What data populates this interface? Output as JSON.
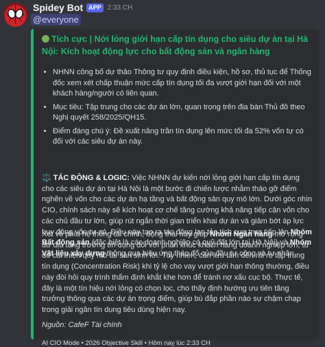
{
  "message": {
    "username": "Spidey Bot",
    "badge": "APP",
    "timestamp": "2:33 CH",
    "mention": "@everyone"
  },
  "embed": {
    "accent_color": "#21b66f",
    "title_icon": "green-circle-icon",
    "title": "Tích cực | Nới lỏng giới hạn cấp tín dụng cho siêu dự án tại Hà Nội: Kích hoạt động lực cho bất động sản và ngân hàng",
    "bullets": [
      "NHNN công bố dự thảo Thông tư quy định điều kiện, hồ sơ, thủ tục để Thống đốc xem xét chấp thuận mức cấp tín dụng tối đa vượt giới hạn đối với một khách hàng/người có liên quan.",
      "Mục tiêu: Tập trung cho các dự án lớn, quan trọng trên địa bàn Thủ đô theo Nghị quyết 258/2025/QH15.",
      "Điểm đáng chú ý: Đề xuất nâng trần tín dụng lên mức tối đa 52% vốn tự có đối với các siêu dự án này."
    ],
    "impact": {
      "icon": "scales-icon",
      "heading": "TÁC ĐỘNG & LOGIC:",
      "text_1": " Việc NHNN dự kiến nới lỏng giới hạn cấp tín dụng cho các siêu dự án tại Hà Nội là một bước đi chiến lược nhằm tháo gỡ điểm nghẽn về vốn cho các dự án hạ tầng và bất động sản quy mô lớn. Dưới góc nhìn CIO, chính sách này sẽ kích hoạt cơ chế tăng cường khả năng tiếp cận vốn cho các chủ đầu tư lớn, giúp rút ngắn thời gian triển khai dự án và giảm bớt áp lực huy động vốn tự có. Điều này tạo ra tác động lan tỏa tích cực trực tiếp lên ",
      "bold_1": "Nhóm Bất động sản",
      "text_2": " (đặc biệt là các doanh nghiệp có quỹ đất lớn tại Hà Nội) và ",
      "bold_2": "Nhóm Vật liệu xây dựng",
      "text_3": " thông qua hiệu ứng thác đổ của đầu tư công và tư nhân."
    },
    "finance": {
      "text_1": "Xét về phía hệ thống tài chính, động thái này giúp ",
      "bold_1": "Nhóm Ngân hàng",
      "text_2": " mở rộng dư địa tăng trưởng tín dụng đối với phân khúc khách hàng doanh nghiệp lớn, từ đó cải thiện quy mô tài sản sinh lời. Tuy nhiên, cần lưu tâm đến rủi ro tập trung tín dụng (Concentration Risk) khi tỷ lệ cho vay vượt giới hạn thông thường, điều này đòi hỏi quy trình thẩm định khắt khe hơn để tránh nợ xấu cục bộ. Thực tế, đây là một tín hiệu nới lỏng có chọn lọc, cho thấy định hướng ưu tiên tăng trưởng thông qua các dự án trọng điểm, giúp bù đắp phần nào sự chậm chạp trong giải ngân tín dụng tiêu dùng hiện nay."
    },
    "source": "Nguồn: CafeF Tài chính",
    "footer": "AI CIO Mode • 2026 Objective Skill • Hôm nay lúc 2:33 CH"
  }
}
